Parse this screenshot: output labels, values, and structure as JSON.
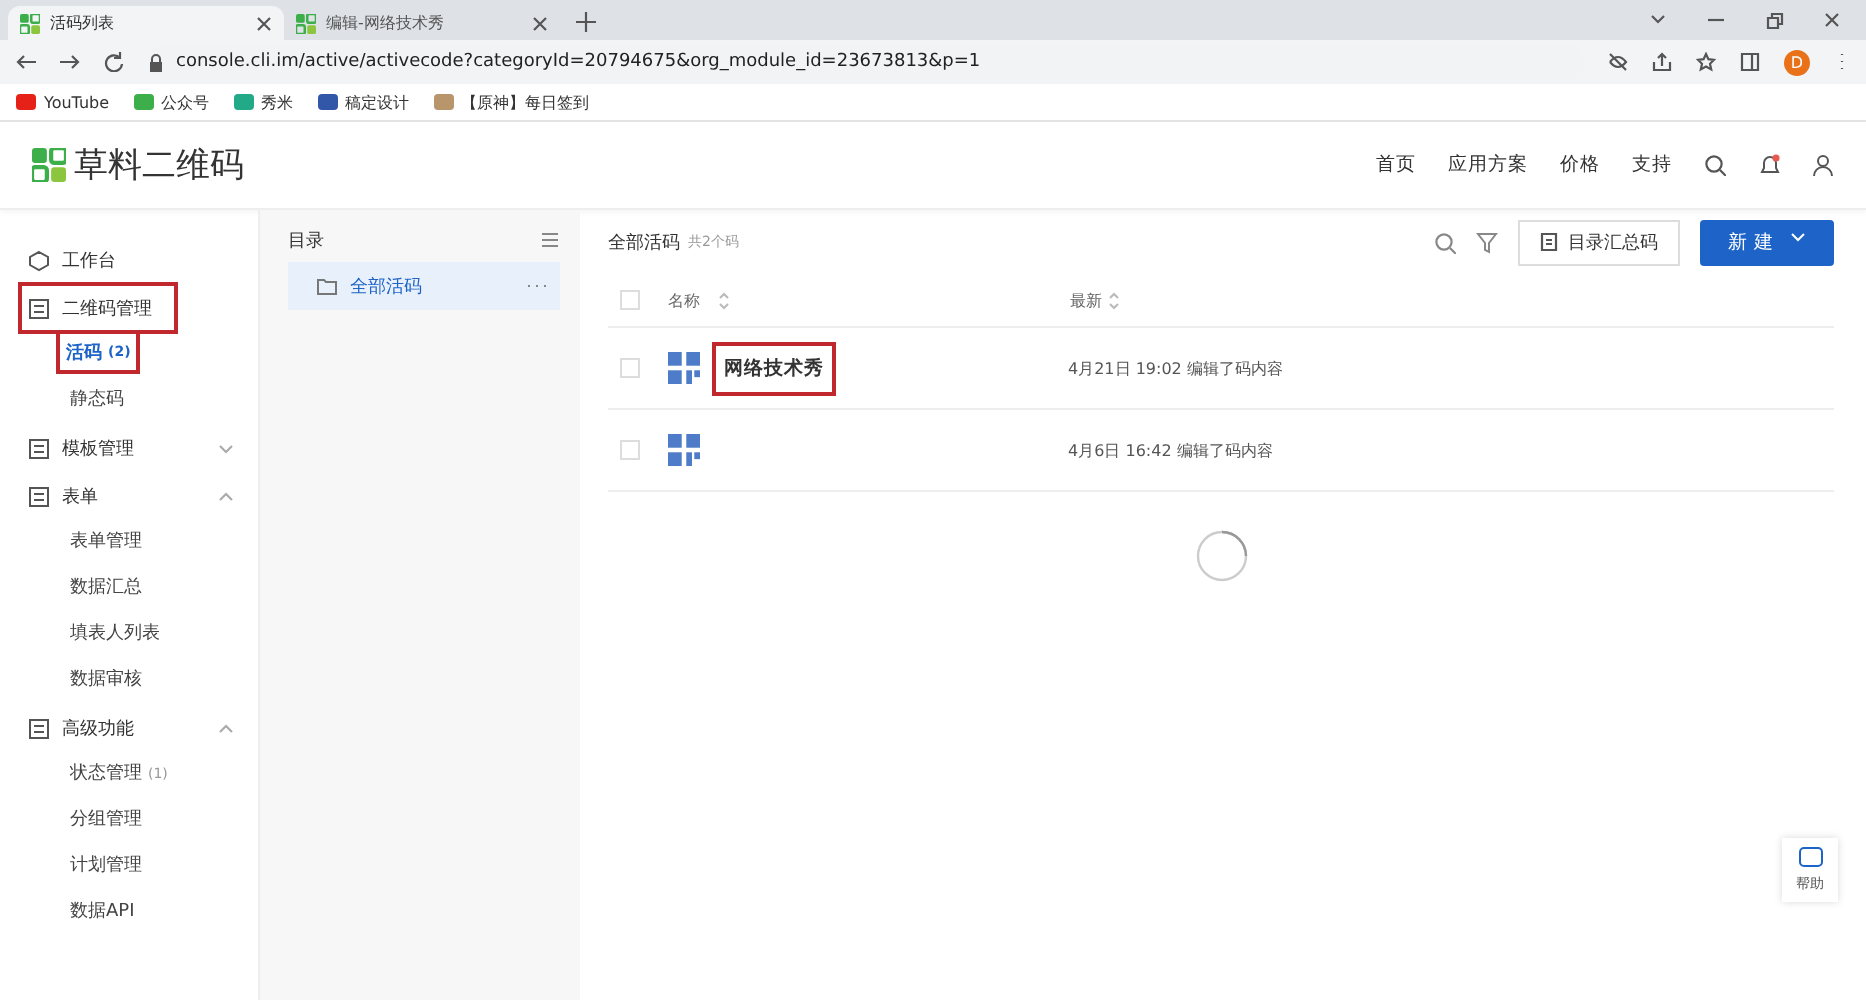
{
  "browser": {
    "tabs": [
      {
        "title": "活码列表",
        "selected": true
      },
      {
        "title": "编辑-网络技术秀",
        "selected": false
      }
    ],
    "url": "console.cli.im/active/activecode?categoryId=20794675&org_module_id=23673813&p=1",
    "avatar": "D",
    "bookmarks": [
      "YouTube",
      "公众号",
      "秀米",
      "稿定设计",
      "【原神】每日签到"
    ]
  },
  "header": {
    "logo": "草料二维码",
    "nav": [
      "首页",
      "应用方案",
      "价格",
      "支持"
    ]
  },
  "sidebar": {
    "items": [
      {
        "kind": "link",
        "label": "工作台"
      },
      {
        "kind": "group",
        "label": "二维码管理",
        "expanded": true,
        "highlighted": true,
        "children": [
          {
            "label": "活码",
            "count": "(2)",
            "selected": true,
            "highlighted": true
          },
          {
            "label": "静态码",
            "selected": false,
            "highlighted": false
          }
        ]
      },
      {
        "kind": "group",
        "label": "模板管理",
        "expanded": false,
        "highlighted": false
      },
      {
        "kind": "group",
        "label": "表单",
        "expanded": true,
        "highlighted": false,
        "children": [
          {
            "label": "表单管理",
            "selected": false,
            "highlighted": false
          },
          {
            "label": "数据汇总",
            "selected": false,
            "highlighted": false
          },
          {
            "label": "填表人列表",
            "selected": false,
            "highlighted": false
          },
          {
            "label": "数据审核",
            "selected": false,
            "highlighted": false
          }
        ]
      },
      {
        "kind": "group",
        "label": "高级功能",
        "expanded": true,
        "highlighted": false,
        "children": [
          {
            "label": "状态管理",
            "count": "(1)",
            "selected": false,
            "highlighted": false
          },
          {
            "label": "分组管理",
            "selected": false,
            "highlighted": false
          },
          {
            "label": "计划管理",
            "selected": false,
            "highlighted": false
          },
          {
            "label": "数据API",
            "selected": false,
            "highlighted": false
          }
        ]
      }
    ]
  },
  "directory": {
    "title": "目录",
    "folders": [
      {
        "label": "全部活码",
        "selected": true
      }
    ]
  },
  "main": {
    "title": "全部活码",
    "count": "共2个码",
    "summary_button": "目录汇总码",
    "new_button": "新 建",
    "columns": [
      "名称",
      "最新"
    ],
    "select_all_checked": false,
    "rows": [
      {
        "name": "网络技术秀",
        "updated": "4月21日 19:02 编辑了码内容",
        "checked": false,
        "highlighted": true
      },
      {
        "updated": "4月6日 16:42 编辑了码内容",
        "checked": false
      }
    ]
  },
  "help": "帮助"
}
